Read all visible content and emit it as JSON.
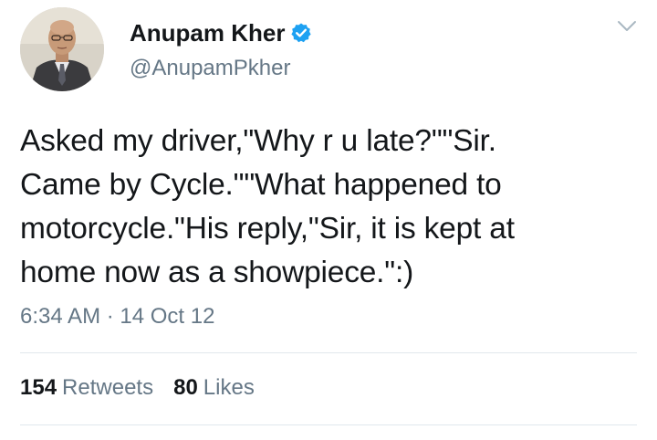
{
  "user": {
    "display_name": "Anupam Kher",
    "handle": "@AnupamPkher",
    "verified_icon": "verified-badge-icon"
  },
  "tweet": {
    "text": "Asked my driver,\"Why r u late?\"\"Sir.\nCame by Cycle.\"\"What happened to\nmotorcycle.\"His reply,\"Sir, it is kept at\nhome now as a showpiece.\":)",
    "timestamp": "6:34 AM · 14 Oct 12"
  },
  "stats": {
    "retweets_count": "154",
    "retweets_label": "Retweets",
    "likes_count": "80",
    "likes_label": "Likes"
  },
  "colors": {
    "text": "#14171a",
    "secondary": "#657786",
    "verified": "#1da1f2",
    "divider": "#e1e8ed"
  }
}
